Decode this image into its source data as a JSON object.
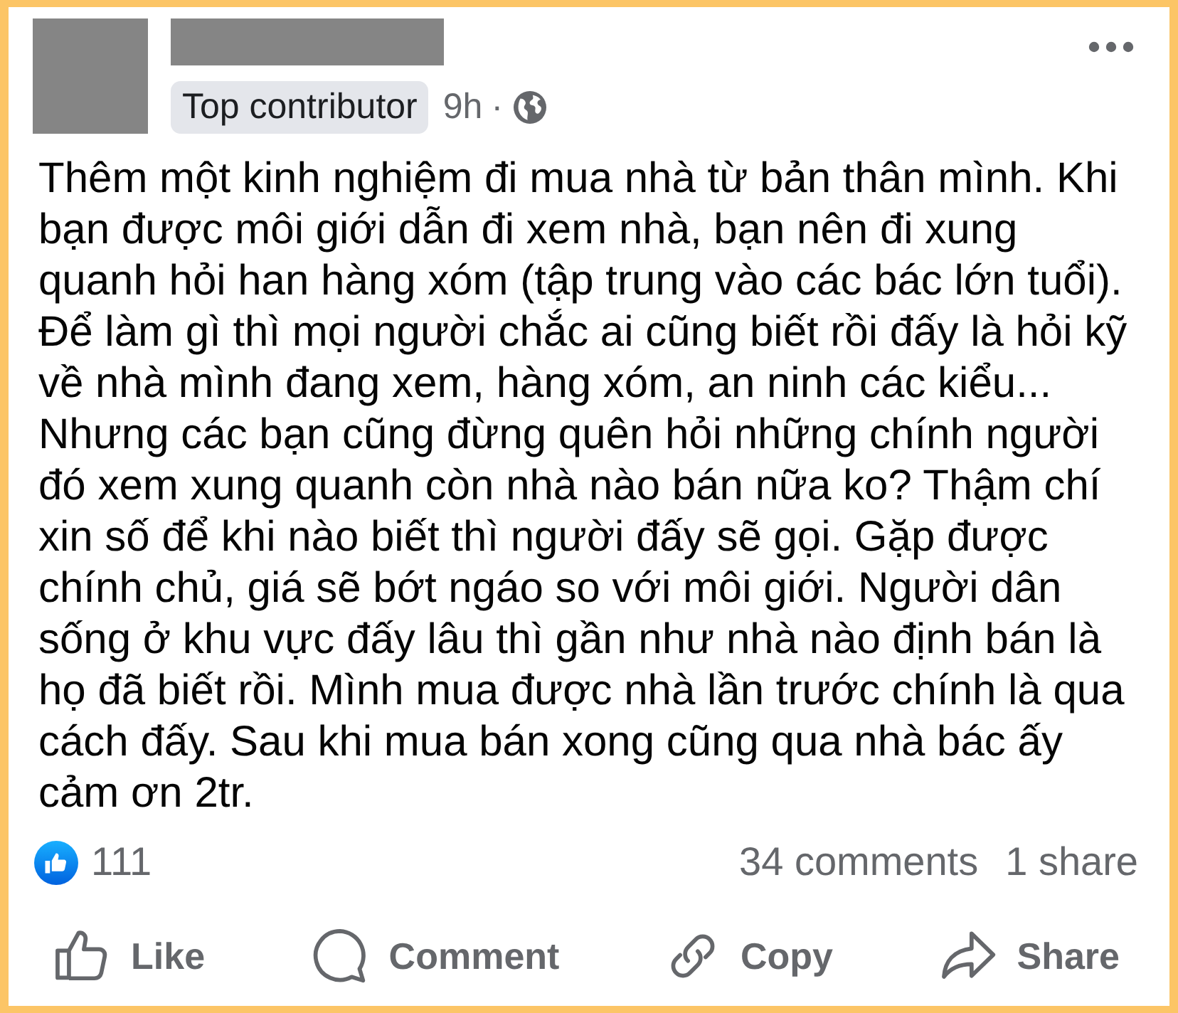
{
  "post": {
    "badge": "Top contributor",
    "time": "9h",
    "separator": "·",
    "text_lines": [
      "Thêm một kinh nghiệm đi mua nhà từ bản thân mình. Khi",
      "bạn được môi giới dẫn đi xem nhà, bạn nên đi xung",
      "quanh hỏi han hàng xóm (tập trung vào các bác lớn tuổi).",
      "Để làm gì thì mọi người chắc ai cũng biết rồi đấy là hỏi kỹ",
      "về nhà mình đang xem, hàng xóm, an ninh các kiểu...",
      "Nhưng các bạn cũng đừng quên hỏi những chính người",
      "đó xem xung quanh còn nhà nào bán nữa ko? Thậm chí",
      "xin số để khi nào biết thì người đấy sẽ gọi. Gặp được",
      "chính chủ, giá sẽ bớt ngáo so với môi giới. Người dân",
      "sống ở khu vực đấy lâu thì gần như nhà nào định bán là",
      "họ đã biết rồi. Mình mua được nhà lần trước chính là qua",
      "cách đấy. Sau khi mua bán xong cũng qua nhà bác ấy",
      "cảm ơn 2tr."
    ]
  },
  "reactions": {
    "count": "111"
  },
  "stats": [
    "34 comments",
    "1 share"
  ],
  "actions": [
    {
      "kind": "like",
      "label": "Like"
    },
    {
      "kind": "comment",
      "label": "Comment"
    },
    {
      "kind": "copy",
      "label": "Copy"
    },
    {
      "kind": "share",
      "label": "Share"
    }
  ]
}
